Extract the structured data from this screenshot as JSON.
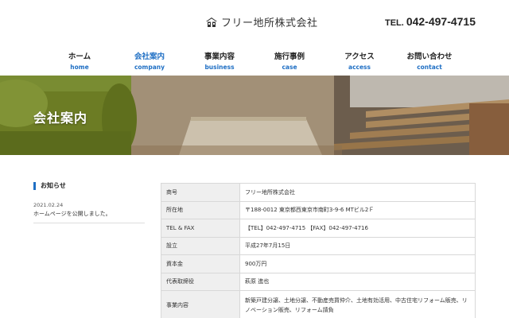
{
  "header": {
    "logo_icon": "house-logo-icon",
    "company_name": "フリー地所株式会社",
    "tel_label": "TEL.",
    "tel_number": "042-497-4715"
  },
  "nav": {
    "items": [
      {
        "jp": "ホーム",
        "en": "home"
      },
      {
        "jp": "会社案内",
        "en": "company"
      },
      {
        "jp": "事業内容",
        "en": "business"
      },
      {
        "jp": "施行事例",
        "en": "case"
      },
      {
        "jp": "アクセス",
        "en": "access"
      },
      {
        "jp": "お問い合わせ",
        "en": "contact"
      }
    ],
    "active_index": 1
  },
  "hero": {
    "title": "会社案内"
  },
  "sidebar": {
    "heading": "お知らせ",
    "news": [
      {
        "date": "2021.02.24",
        "title": "ホームページを公開しました。"
      }
    ]
  },
  "company_table": {
    "rows": [
      {
        "label": "商号",
        "value": "フリー地所株式会社"
      },
      {
        "label": "所在地",
        "value": "〒188-0012 東京都西東京市南町3-9-6 MTビル2Ｆ"
      },
      {
        "label": "TEL & FAX",
        "value": "【TEL】042-497-4715 【FAX】042-497-4716"
      },
      {
        "label": "設立",
        "value": "平成27年7月15日"
      },
      {
        "label": "資本金",
        "value": "900万円"
      },
      {
        "label": "代表取締役",
        "value": "萩原 進也"
      },
      {
        "label": "事業内容",
        "value_line1": "新築戸建分譲、土地分譲、不動産売買仲介、土地有効活用、中古住宅リフォーム販売、リ",
        "value_line2": "ノベーション販売、リフォーム請負"
      }
    ]
  },
  "colors": {
    "accent": "#1f6fc4",
    "table_header_bg": "#efefef",
    "border": "#d8d8d8"
  }
}
